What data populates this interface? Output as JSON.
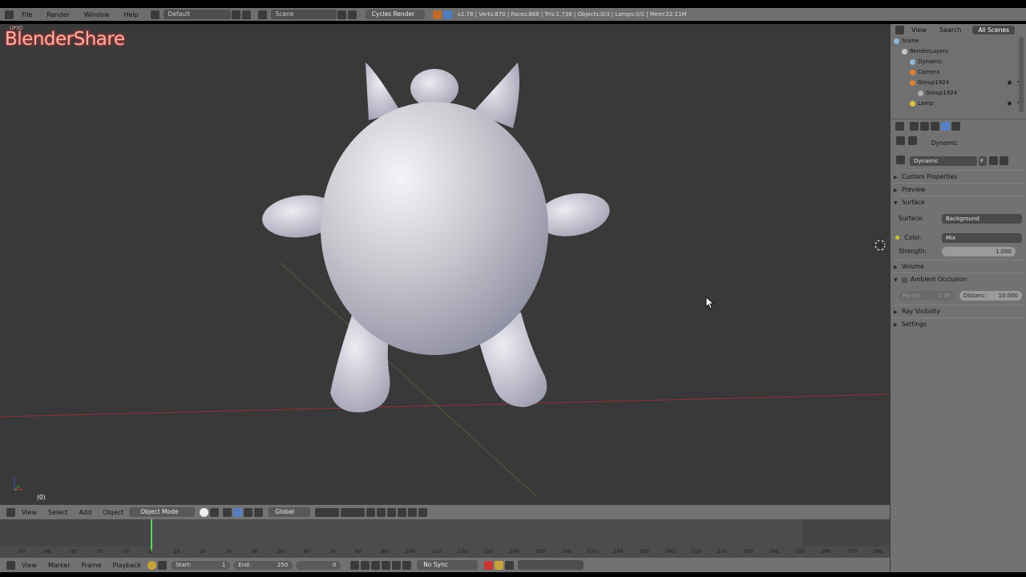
{
  "topbar": {
    "menus": [
      "File",
      "Render",
      "Window",
      "Help"
    ],
    "layout": "Default",
    "scene": "Scene",
    "engine": "Cycles Render",
    "stats": "v2.78 | Verts:870 | Faces:868 | Tris:1,736 | Objects:0/3 | Lamps:0/1 | Mem:22.11M"
  },
  "viewport": {
    "logo_small": "UP3D",
    "logo": "BlenderShare",
    "frame_label": "(0)"
  },
  "view3d_header": {
    "menus": [
      "View",
      "Select",
      "Add",
      "Object"
    ],
    "mode": "Object Mode",
    "orientation": "Global"
  },
  "timeline": {
    "ticks": [
      "-50",
      "-40",
      "-30",
      "-20",
      "-10",
      "0",
      "10",
      "20",
      "30",
      "40",
      "50",
      "60",
      "70",
      "80",
      "90",
      "100",
      "110",
      "120",
      "130",
      "140",
      "150",
      "160",
      "170",
      "180",
      "190",
      "200",
      "210",
      "220",
      "230",
      "240",
      "250",
      "260",
      "270",
      "280"
    ],
    "menus": [
      "View",
      "Marker",
      "Frame",
      "Playback"
    ],
    "start_label": "Start:",
    "start_value": "1",
    "end_label": "End:",
    "end_value": "250",
    "current": "0",
    "sync": "No Sync"
  },
  "outliner": {
    "menus": [
      "View",
      "Search"
    ],
    "filter": "All Scenes",
    "rows": [
      {
        "label": "Scene",
        "color": "#8fb7d8"
      },
      {
        "label": "RenderLayers",
        "color": "#c8c8c8"
      },
      {
        "label": "Dynamic",
        "color": "#8fb7d8"
      },
      {
        "label": "Camera",
        "color": "#e08030"
      },
      {
        "label": "Group1924",
        "color": "#e08030"
      },
      {
        "label": "Group1924",
        "color": "#b0b0b0"
      },
      {
        "label": "Lamp",
        "color": "#e0c040"
      }
    ]
  },
  "properties": {
    "breadcrumb": "Dynamic",
    "world_name": "Dynamic",
    "world_flag": "F",
    "panels": {
      "custom_properties": "Custom Properties",
      "preview": "Preview",
      "surface": "Surface",
      "volume": "Volume",
      "ambient_occlusion": "Ambient Occlusion",
      "ray_visibility": "Ray Visibility",
      "settings": "Settings"
    },
    "surface_label": "Surface:",
    "surface_value": "Background",
    "color_label": "Color:",
    "color_value": "Mix",
    "strength_label": "Strength:",
    "strength_value": "1.000",
    "factor_label": "Factor:",
    "factor_value": "1.00",
    "distance_label": "Distanc:",
    "distance_value": "10.000"
  },
  "colors": {
    "viewport_bg": "#393939",
    "mesh": "#c9c9d4",
    "x_axis": "#a0353a",
    "y_axis": "#5b7b3a",
    "playhead": "#5fd15f",
    "selection": "#5680c2"
  }
}
